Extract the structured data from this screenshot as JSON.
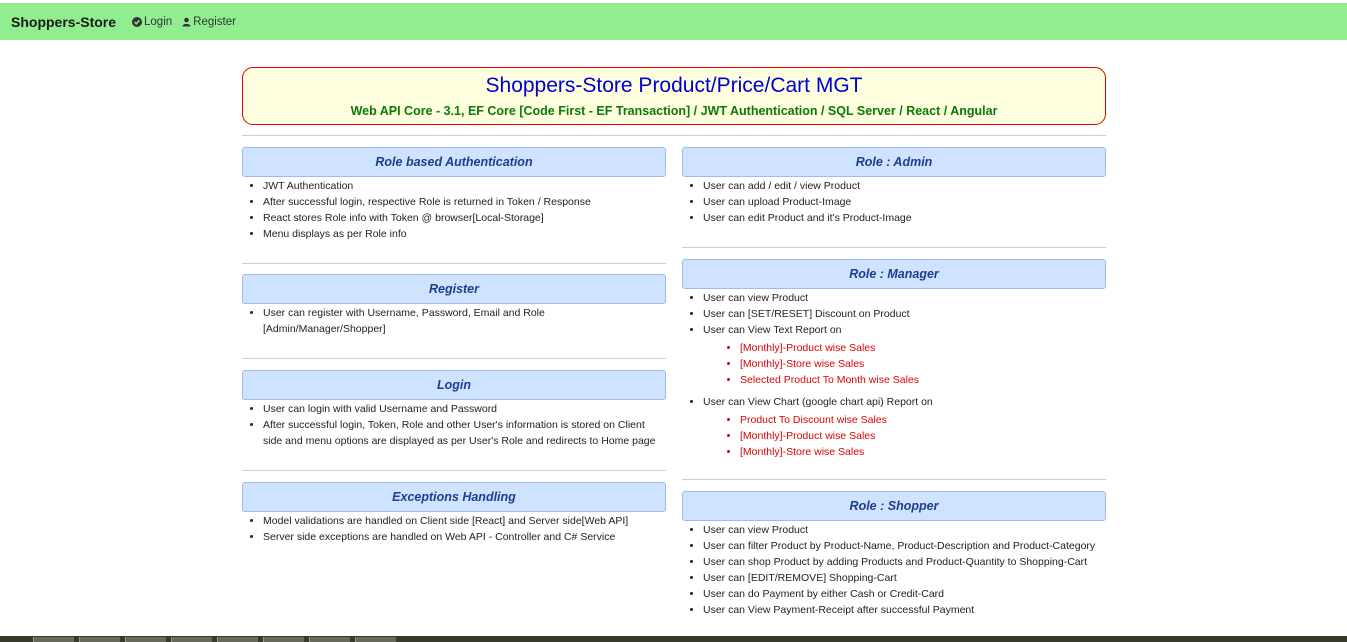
{
  "navbar": {
    "brand": "Shoppers-Store",
    "login": "Login",
    "register": "Register"
  },
  "hero": {
    "title": "Shoppers-Store Product/Price/Cart MGT",
    "subtitle": "Web API Core - 3.1, EF Core [Code First - EF Transaction] / JWT Authentication / SQL Server / React / Angular"
  },
  "left": [
    {
      "title": "Role based Authentication",
      "items": [
        "JWT Authentication",
        "After successful login, respective Role is returned in Token / Response",
        "React stores Role info with Token @ browser[Local-Storage]",
        "Menu displays as per Role info"
      ]
    },
    {
      "title": "Register",
      "items": [
        "User can register with Username, Password, Email and Role [Admin/Manager/Shopper]"
      ]
    },
    {
      "title": "Login",
      "items": [
        "User can login with valid Username and Password",
        "After successful login, Token, Role and other User's information is stored on Client side and menu options are displayed as per User's Role and redirects to Home page"
      ]
    },
    {
      "title": "Exceptions Handling",
      "items": [
        "Model validations are handled on Client side [React] and Server side[Web API]",
        "Server side exceptions are handled on Web API - Controller and C# Service"
      ]
    }
  ],
  "right": [
    {
      "title": "Role : Admin",
      "items": [
        "User can add / edit / view Product",
        "User can upload Product-Image",
        "User can edit Product and it's Product-Image"
      ]
    },
    {
      "title": "Role : Manager",
      "items": [
        "User can view Product",
        "User can [SET/RESET] Discount on Product",
        "User can View Text Report on",
        "User can View Chart (google chart api) Report on"
      ],
      "text_report": [
        "[Monthly]-Product wise Sales",
        "[Monthly]-Store wise Sales",
        "Selected Product To Month wise Sales"
      ],
      "chart_report": [
        "Product To Discount wise Sales",
        "[Monthly]-Product wise Sales",
        "[Monthly]-Store wise Sales"
      ]
    },
    {
      "title": "Role : Shopper",
      "items": [
        "User can view Product",
        "User can filter Product by Product-Name, Product-Description and Product-Category",
        "User can shop Product by adding Products and Product-Quantity to Shopping-Cart",
        "User can [EDIT/REMOVE] Shopping-Cart",
        "User can do Payment by either Cash or Credit-Card",
        "User can View Payment-Receipt after successful Payment"
      ]
    }
  ],
  "colors": {
    "navbar_bg": "#90ee90",
    "hero_border": "#e00000",
    "hero_bg": "#ffffe0",
    "hero_title": "#0000cc",
    "hero_subtitle": "#0a7a0a",
    "section_head_bg": "#cfe2ff",
    "section_head_text": "#1c3f8c",
    "report_item": "#dd0000"
  }
}
